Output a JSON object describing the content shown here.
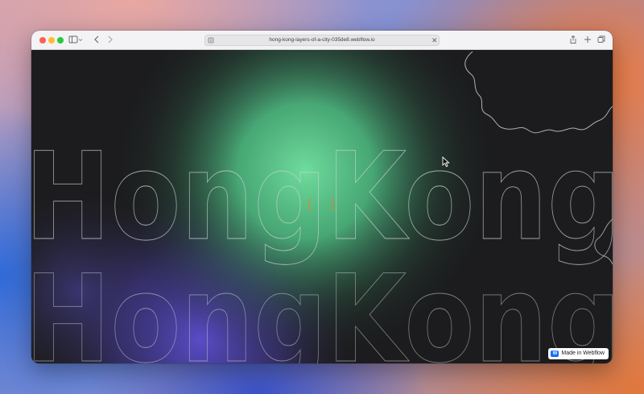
{
  "browser": {
    "url": "hong-kong-layers-of-a-city-035de8.webflow.io",
    "icons": {
      "sidebar": "sidebar-icon",
      "back": "chevron-left-icon",
      "forward": "chevron-right-icon",
      "share": "share-icon",
      "new_tab": "plus-icon",
      "tabs": "tabs-overview-icon",
      "close": "close-icon",
      "reader": "reader-icon"
    }
  },
  "hero": {
    "line1": "HongKong",
    "line2": "HongKong"
  },
  "badge": {
    "label": "Made in Webflow",
    "logo": "W"
  },
  "colors": {
    "glow_green": "#67d79a",
    "glow_purple": "#5a4fc4",
    "background": "#1c1c1e",
    "outline": "#cfd6d2"
  }
}
